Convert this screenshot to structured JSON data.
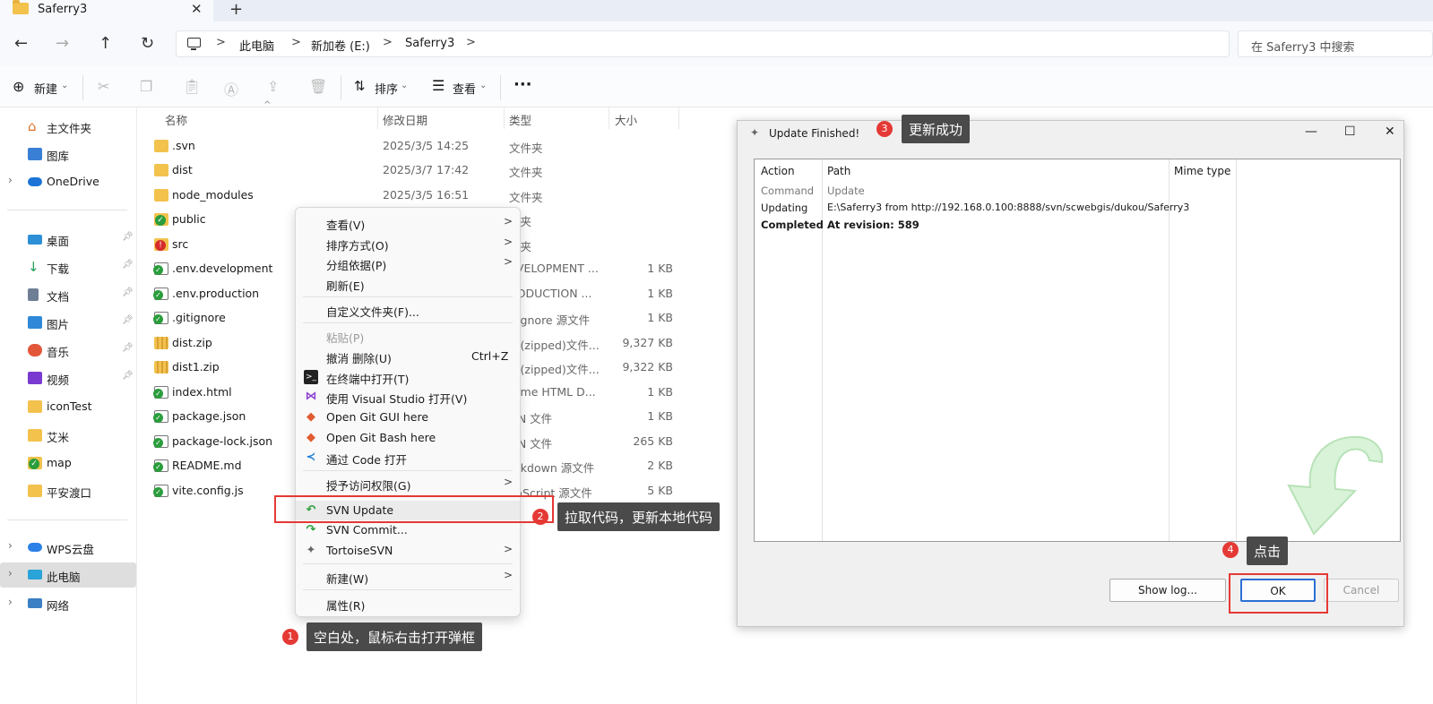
{
  "window": {
    "tab_title": "Saferry3",
    "tab_close": "✕",
    "new_tab": "+"
  },
  "nav": {
    "back": "←",
    "forward": "→",
    "up": "↑",
    "refresh": "↻",
    "sep": ">",
    "breadcrumb": [
      "此电脑",
      "新加卷 (E:)",
      "Saferry3"
    ],
    "search_placeholder": "在 Saferry3 中搜索"
  },
  "toolbar": {
    "new_label": "新建",
    "sort_label": "排序",
    "view_label": "查看",
    "more": "···"
  },
  "sidebar": {
    "items": [
      {
        "label": "主文件夹"
      },
      {
        "label": "图库"
      },
      {
        "label": "OneDrive"
      },
      {
        "label": "桌面"
      },
      {
        "label": "下载"
      },
      {
        "label": "文档"
      },
      {
        "label": "图片"
      },
      {
        "label": "音乐"
      },
      {
        "label": "视频"
      },
      {
        "label": "iconTest"
      },
      {
        "label": "艾米"
      },
      {
        "label": "map"
      },
      {
        "label": "平安渡口"
      },
      {
        "label": "WPS云盘"
      },
      {
        "label": "此电脑"
      },
      {
        "label": "网络"
      }
    ]
  },
  "columns": {
    "name": "名称",
    "date": "修改日期",
    "type": "类型",
    "size": "大小"
  },
  "files": [
    {
      "name": ".svn",
      "date": "2025/3/5 14:25",
      "type": "文件夹",
      "size": ""
    },
    {
      "name": "dist",
      "date": "2025/3/7 17:42",
      "type": "文件夹",
      "size": ""
    },
    {
      "name": "node_modules",
      "date": "2025/3/5 16:51",
      "type": "文件夹",
      "size": ""
    },
    {
      "name": "public",
      "date": "",
      "type": "件夹",
      "size": ""
    },
    {
      "name": "src",
      "date": "",
      "type": "件夹",
      "size": ""
    },
    {
      "name": ".env.development",
      "date": "",
      "type": "EVELOPMENT ...",
      "size": "1 KB"
    },
    {
      "name": ".env.production",
      "date": "",
      "type": "RODUCTION ...",
      "size": "1 KB"
    },
    {
      "name": ".gitignore",
      "date": "",
      "type": "t Ignore 源文件",
      "size": "1 KB"
    },
    {
      "name": "dist.zip",
      "date": "",
      "type": "缩(zipped)文件...",
      "size": "9,327 KB"
    },
    {
      "name": "dist1.zip",
      "date": "",
      "type": "缩(zipped)文件...",
      "size": "9,322 KB"
    },
    {
      "name": "index.html",
      "date": "",
      "type": "rome HTML D...",
      "size": "1 KB"
    },
    {
      "name": "package.json",
      "date": "",
      "type": "ON 文件",
      "size": "1 KB"
    },
    {
      "name": "package-lock.json",
      "date": "",
      "type": "ON 文件",
      "size": "265 KB"
    },
    {
      "name": "README.md",
      "date": "",
      "type": "arkdown 源文件",
      "size": "2 KB"
    },
    {
      "name": "vite.config.js",
      "date": "",
      "type": "vaScript 源文件",
      "size": "5 KB"
    }
  ],
  "context_menu": {
    "view": "查看(V)",
    "sort": "排序方式(O)",
    "group": "分组依据(P)",
    "refresh": "刷新(E)",
    "customize": "自定义文件夹(F)...",
    "paste": "粘贴(P)",
    "undo": "撤消 删除(U)",
    "undo_shortcut": "Ctrl+Z",
    "terminal": "在终端中打开(T)",
    "vs": "使用 Visual Studio 打开(V)",
    "git_gui": "Open Git GUI here",
    "git_bash": "Open Git Bash here",
    "code": "通过 Code 打开",
    "access": "授予访问权限(G)",
    "svn_update": "SVN Update",
    "svn_commit": "SVN Commit...",
    "tortoise": "TortoiseSVN",
    "new": "新建(W)",
    "props": "属性(R)",
    "arrow": ">"
  },
  "dialog": {
    "title": "Update Finished!",
    "minimize": "—",
    "maximize": "☐",
    "close": "✕",
    "headers": {
      "action": "Action",
      "path": "Path",
      "mime": "Mime type"
    },
    "rows": [
      {
        "action": "Command",
        "path": "Update",
        "style": "gray"
      },
      {
        "action": "Updating",
        "path": "E:\\Saferry3 from http://192.168.0.100:8888/svn/scwebgis/dukou/Saferry3",
        "style": "normal"
      },
      {
        "action": "Completed",
        "path": "At revision: 589",
        "style": "bold"
      }
    ],
    "show_log": "Show log...",
    "ok": "OK",
    "cancel": "Cancel"
  },
  "annotations": [
    {
      "num": "1",
      "text": "空白处，鼠标右击打开弹框"
    },
    {
      "num": "2",
      "text": "拉取代码，更新本地代码"
    },
    {
      "num": "3",
      "text": "更新成功"
    },
    {
      "num": "4",
      "text": "点击"
    }
  ]
}
